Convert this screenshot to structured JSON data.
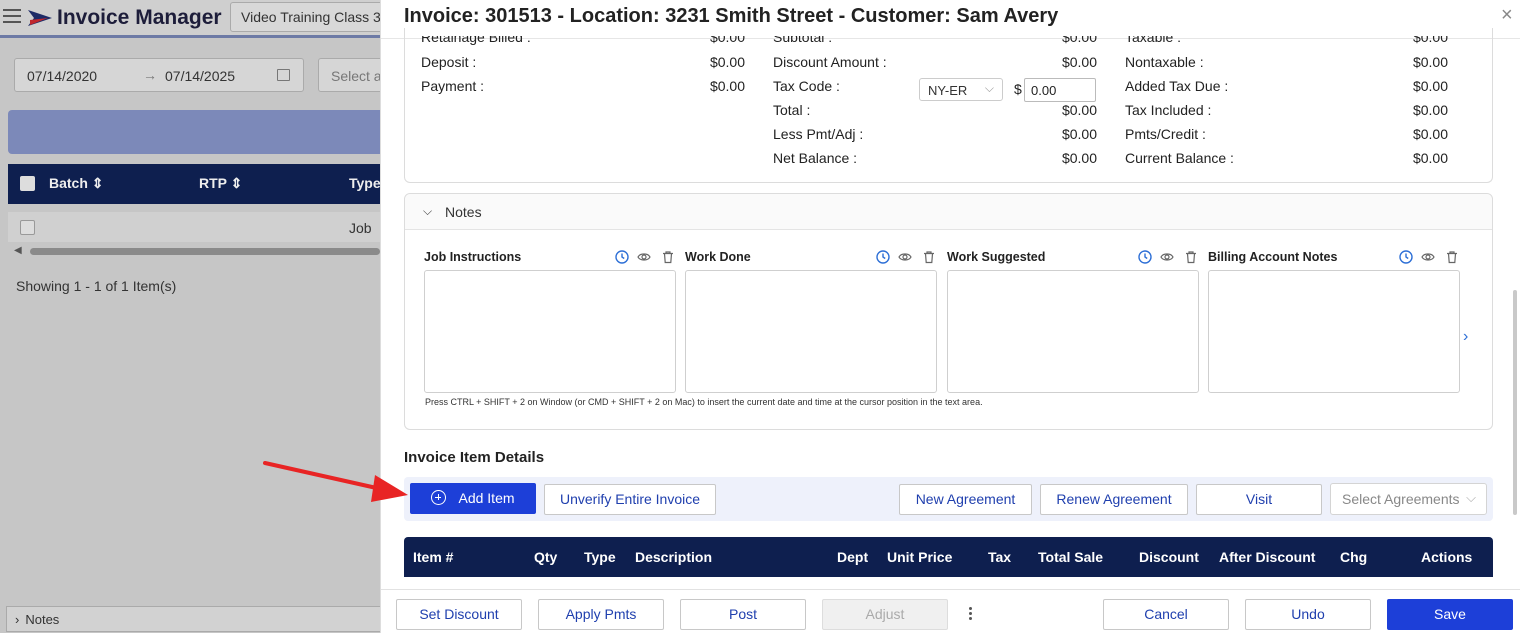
{
  "background": {
    "app_title": "Invoice Manager",
    "tab_label": "Video Training Class 3",
    "date_from": "07/14/2020",
    "date_arrow": "→",
    "date_to": "07/14/2025",
    "select_placeholder": "Select a",
    "columns": [
      "Batch",
      "RTP",
      "Type"
    ],
    "row_type": "Job",
    "showing": "Showing 1 - 1 of 1 Item(s)",
    "notes_label": "Notes"
  },
  "drawer": {
    "title": "Invoice: 301513 - Location: 3231 Smith Street - Customer: Sam Avery",
    "close_icon": "×"
  },
  "summary": {
    "col1": [
      {
        "label": "Retainage Billed :",
        "value": "$0.00"
      },
      {
        "label": "Deposit :",
        "value": "$0.00"
      },
      {
        "label": "Payment :",
        "value": "$0.00"
      }
    ],
    "col2": [
      {
        "label": "Subtotal :",
        "value": "$0.00"
      },
      {
        "label": "Discount Amount :",
        "value": "$0.00"
      },
      {
        "label": "Tax Code :",
        "value": ""
      },
      {
        "label": "Total :",
        "value": "$0.00"
      },
      {
        "label": "Less Pmt/Adj :",
        "value": "$0.00"
      },
      {
        "label": "Net Balance :",
        "value": "$0.00"
      }
    ],
    "col3": [
      {
        "label": "Taxable :",
        "value": "$0.00"
      },
      {
        "label": "Nontaxable :",
        "value": "$0.00"
      },
      {
        "label": "Added Tax Due :",
        "value": "$0.00"
      },
      {
        "label": "Tax Included :",
        "value": "$0.00"
      },
      {
        "label": "Pmts/Credit :",
        "value": "$0.00"
      },
      {
        "label": "Current Balance :",
        "value": "$0.00"
      }
    ],
    "tax_code": "NY-ER",
    "tax_currency": "$",
    "tax_amount": "0.00"
  },
  "notes": {
    "header": "Notes",
    "columns": [
      "Job Instructions",
      "Work Done",
      "Work Suggested",
      "Billing Account Notes"
    ],
    "hint": "Press CTRL + SHIFT + 2 on Window (or CMD + SHIFT + 2 on Mac) to insert the current date and time at the cursor position in the text area."
  },
  "items": {
    "heading": "Invoice Item Details",
    "add_item": "Add Item",
    "unverify": "Unverify Entire Invoice",
    "new_agreement": "New Agreement",
    "renew_agreement": "Renew Agreement",
    "visit": "Visit",
    "select_agreements": "Select Agreements",
    "table_columns": [
      "Item #",
      "Qty",
      "Type",
      "Description",
      "Dept",
      "Unit Price",
      "Tax",
      "Total Sale",
      "Discount",
      "After Discount",
      "Chg",
      "Actions"
    ]
  },
  "footer": {
    "set_discount": "Set Discount",
    "apply_pmts": "Apply Pmts",
    "post": "Post",
    "adjust": "Adjust",
    "cancel": "Cancel",
    "undo": "Undo",
    "save": "Save"
  },
  "colors": {
    "primary": "#1d3fd8",
    "header_navy": "#0e1f4f",
    "arrow_red": "#e82424"
  }
}
